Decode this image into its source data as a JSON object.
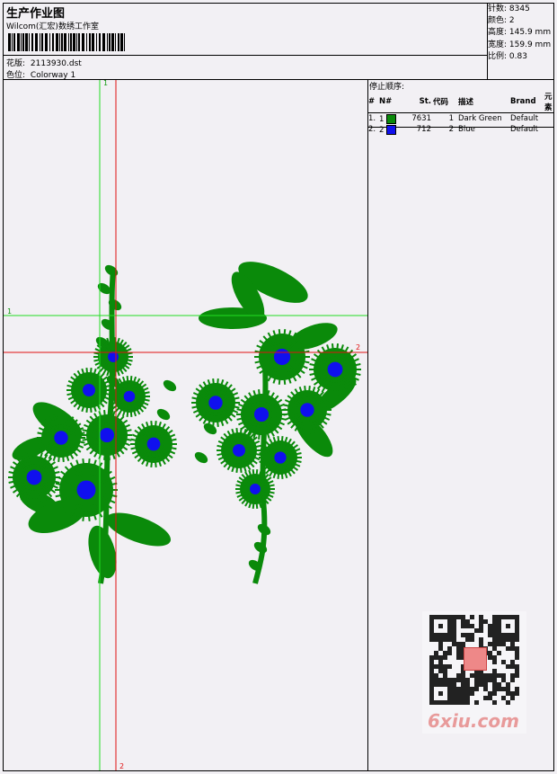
{
  "header": {
    "title": "生产作业图",
    "studio": "Wilcom(汇宏)数绣工作室",
    "design_label": "花版:",
    "design_value": "2113930.dst",
    "colorway_label": "色位:",
    "colorway_value": "Colorway 1"
  },
  "stats": {
    "stitches_label": "针数:",
    "stitches_value": "8345",
    "colors_label": "颜色:",
    "colors_value": "2",
    "height_label": "高度:",
    "height_value": "145.9 mm",
    "width_label": "宽度:",
    "width_value": "159.9 mm",
    "scale_label": "比例:",
    "scale_value": "0.83"
  },
  "stop_sequence": {
    "title": "停止顺序:",
    "columns": [
      "#",
      "N#",
      "St.",
      "代码",
      "描述",
      "Brand",
      "元素"
    ],
    "rows": [
      {
        "idx": "1.",
        "n": "1",
        "swatch": "#0a8a0a",
        "stitches": "7631",
        "code": "1",
        "desc": "Dark Green",
        "brand": "Default",
        "element": ""
      },
      {
        "idx": "2.",
        "n": "2",
        "swatch": "#1010ee",
        "stitches": "712",
        "code": "2",
        "desc": "Blue",
        "brand": "Default",
        "element": ""
      }
    ]
  },
  "guides": {
    "green_v_label": "1",
    "green_h_label": "1",
    "red_h_label": "2",
    "red_v_label": "2"
  },
  "colors": {
    "green": "#0a8a0a",
    "blue": "#1010ee",
    "guide_green": "#22dd22",
    "guide_red": "#e01010"
  },
  "watermark": {
    "site": "6xiu.com",
    "icons": [
      "qr-code-icon",
      "seal-stamp-icon"
    ]
  }
}
